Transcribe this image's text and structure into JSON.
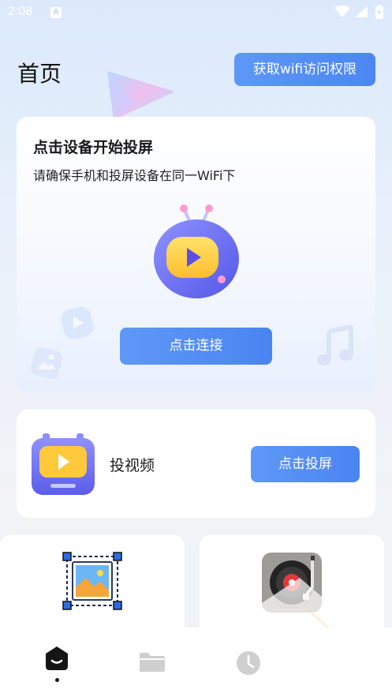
{
  "status": {
    "time": "2:08",
    "notification_letter": "A"
  },
  "header": {
    "title": "首页",
    "wifi_button": "获取wifi访问权限"
  },
  "hero": {
    "title": "点击设备开始投屏",
    "subtitle": "请确保手机和投屏设备在同一WiFi下",
    "connect_button": "点击连接"
  },
  "cast_video": {
    "label": "投视频",
    "button": "点击投屏"
  },
  "features": [
    {
      "icon": "photo-icon"
    },
    {
      "icon": "record-player-icon"
    }
  ],
  "bottom_nav": {
    "items": [
      {
        "icon": "home-icon",
        "active": true
      },
      {
        "icon": "folder-icon",
        "active": false
      },
      {
        "icon": "clock-icon",
        "active": false
      }
    ]
  },
  "colors": {
    "accent": "#4c86f2",
    "accent_light": "#5f98f6",
    "card": "#ffffff",
    "background": "#f1f3f6",
    "tv_purple": "#6b6cf0",
    "tv_screen": "#ffc93b"
  }
}
